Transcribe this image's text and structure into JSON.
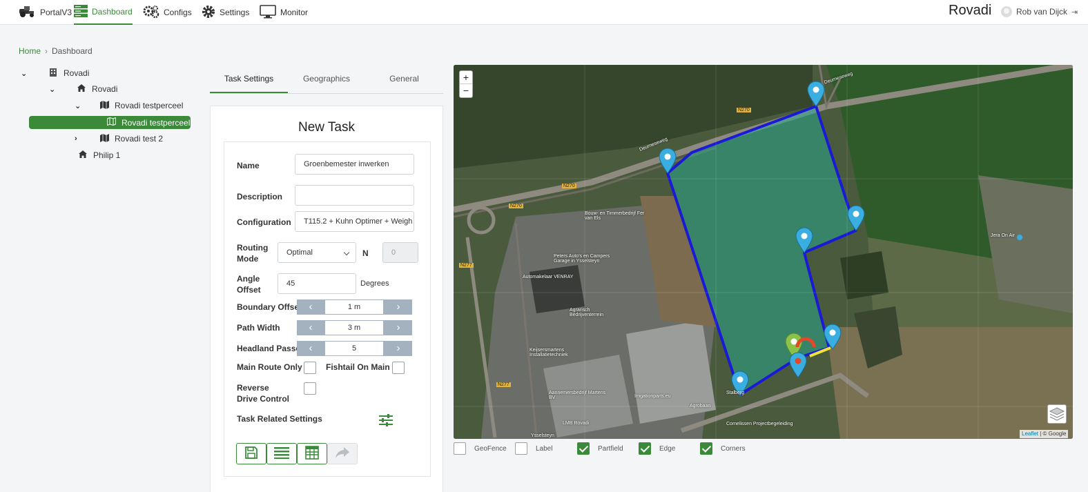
{
  "nav": {
    "portal_label": "PortalV3",
    "items": [
      {
        "label": "Dashboard",
        "icon": "dashboard-icon",
        "active": true
      },
      {
        "label": "Configs",
        "icon": "gears-icon"
      },
      {
        "label": "Settings",
        "icon": "gear-icon"
      },
      {
        "label": "Monitor",
        "icon": "monitor-icon"
      }
    ],
    "brand": "Rovadi",
    "user": "Rob van Dijck"
  },
  "breadcrumb": {
    "home": "Home",
    "current": "Dashboard"
  },
  "tree": [
    {
      "label": "Rovadi",
      "icon": "building-icon",
      "expanded": true
    },
    {
      "label": "Rovadi",
      "icon": "home-icon",
      "expanded": true
    },
    {
      "label": "Rovadi testperceel",
      "icon": "map-icon",
      "expanded": true
    },
    {
      "label": "Rovadi testperceel",
      "icon": "map-outline-icon",
      "selected": true
    },
    {
      "label": "Rovadi test 2",
      "icon": "map-icon",
      "expanded": false
    },
    {
      "label": "Philip 1",
      "icon": "home-icon"
    }
  ],
  "tabs": [
    {
      "label": "Task Settings",
      "active": true
    },
    {
      "label": "Geographics"
    },
    {
      "label": "General"
    }
  ],
  "task": {
    "title": "New Task",
    "name_label": "Name",
    "name_value": "Groenbemester inwerken",
    "description_label": "Description",
    "description_value": "",
    "configuration_label": "Configuration",
    "configuration_value": "T115.2 + Kuhn Optimer + Weigh",
    "routing_label": "Routing Mode",
    "routing_value": "Optimal",
    "n_label": "N",
    "n_value": "0",
    "angle_label": "Angle Offset",
    "angle_value": "45",
    "angle_unit": "Degrees",
    "boundary_label": "Boundary Offset",
    "boundary_value": "1 m",
    "path_label": "Path Width",
    "path_value": "3 m",
    "headland_label": "Headland Passes",
    "headland_value": "5",
    "main_route_label": "Main Route Only",
    "fishtail_label": "Fishtail On Main",
    "reverse_label": "Reverse Drive Control",
    "related_label": "Task Related Settings"
  },
  "map": {
    "zoom_in": "+",
    "zoom_out": "−",
    "attribution_link": "Leaflet",
    "attribution_rest": " | © Google",
    "labels": [
      "Deurneseweg",
      "Deurneseweg",
      "N270",
      "N270",
      "N270",
      "N277",
      "N277",
      "Bouw- en Timmerbedrijf Fer van Els",
      "Peters Auto's en Campers Garage in Ysselsteyn",
      "Automakelaar VENRAY",
      "Agrarisch Bedrijventerrein",
      "Keijsersmartens Installatietechniek",
      "Aannemersbedrijf Martens BV",
      "Irrigationparts.eu",
      "Jera On Air",
      "Stalberg",
      "Cornelissen Projectbegeleiding",
      "LMB Rovadi",
      "Agrobaan",
      "Ysselsteyn"
    ],
    "colors": {
      "boundary": "#1a1ad6",
      "field_fill": "#2aa88c",
      "marker": "#3aaee0",
      "start": "#8bc34a",
      "end": "#e04a2a",
      "segment": "#f2e436"
    }
  },
  "map_options": [
    {
      "label": "GeoFence",
      "checked": false
    },
    {
      "label": "Label",
      "checked": false
    },
    {
      "label": "Partfield",
      "checked": true
    },
    {
      "label": "Edge",
      "checked": true
    },
    {
      "label": "Corners",
      "checked": true
    }
  ]
}
